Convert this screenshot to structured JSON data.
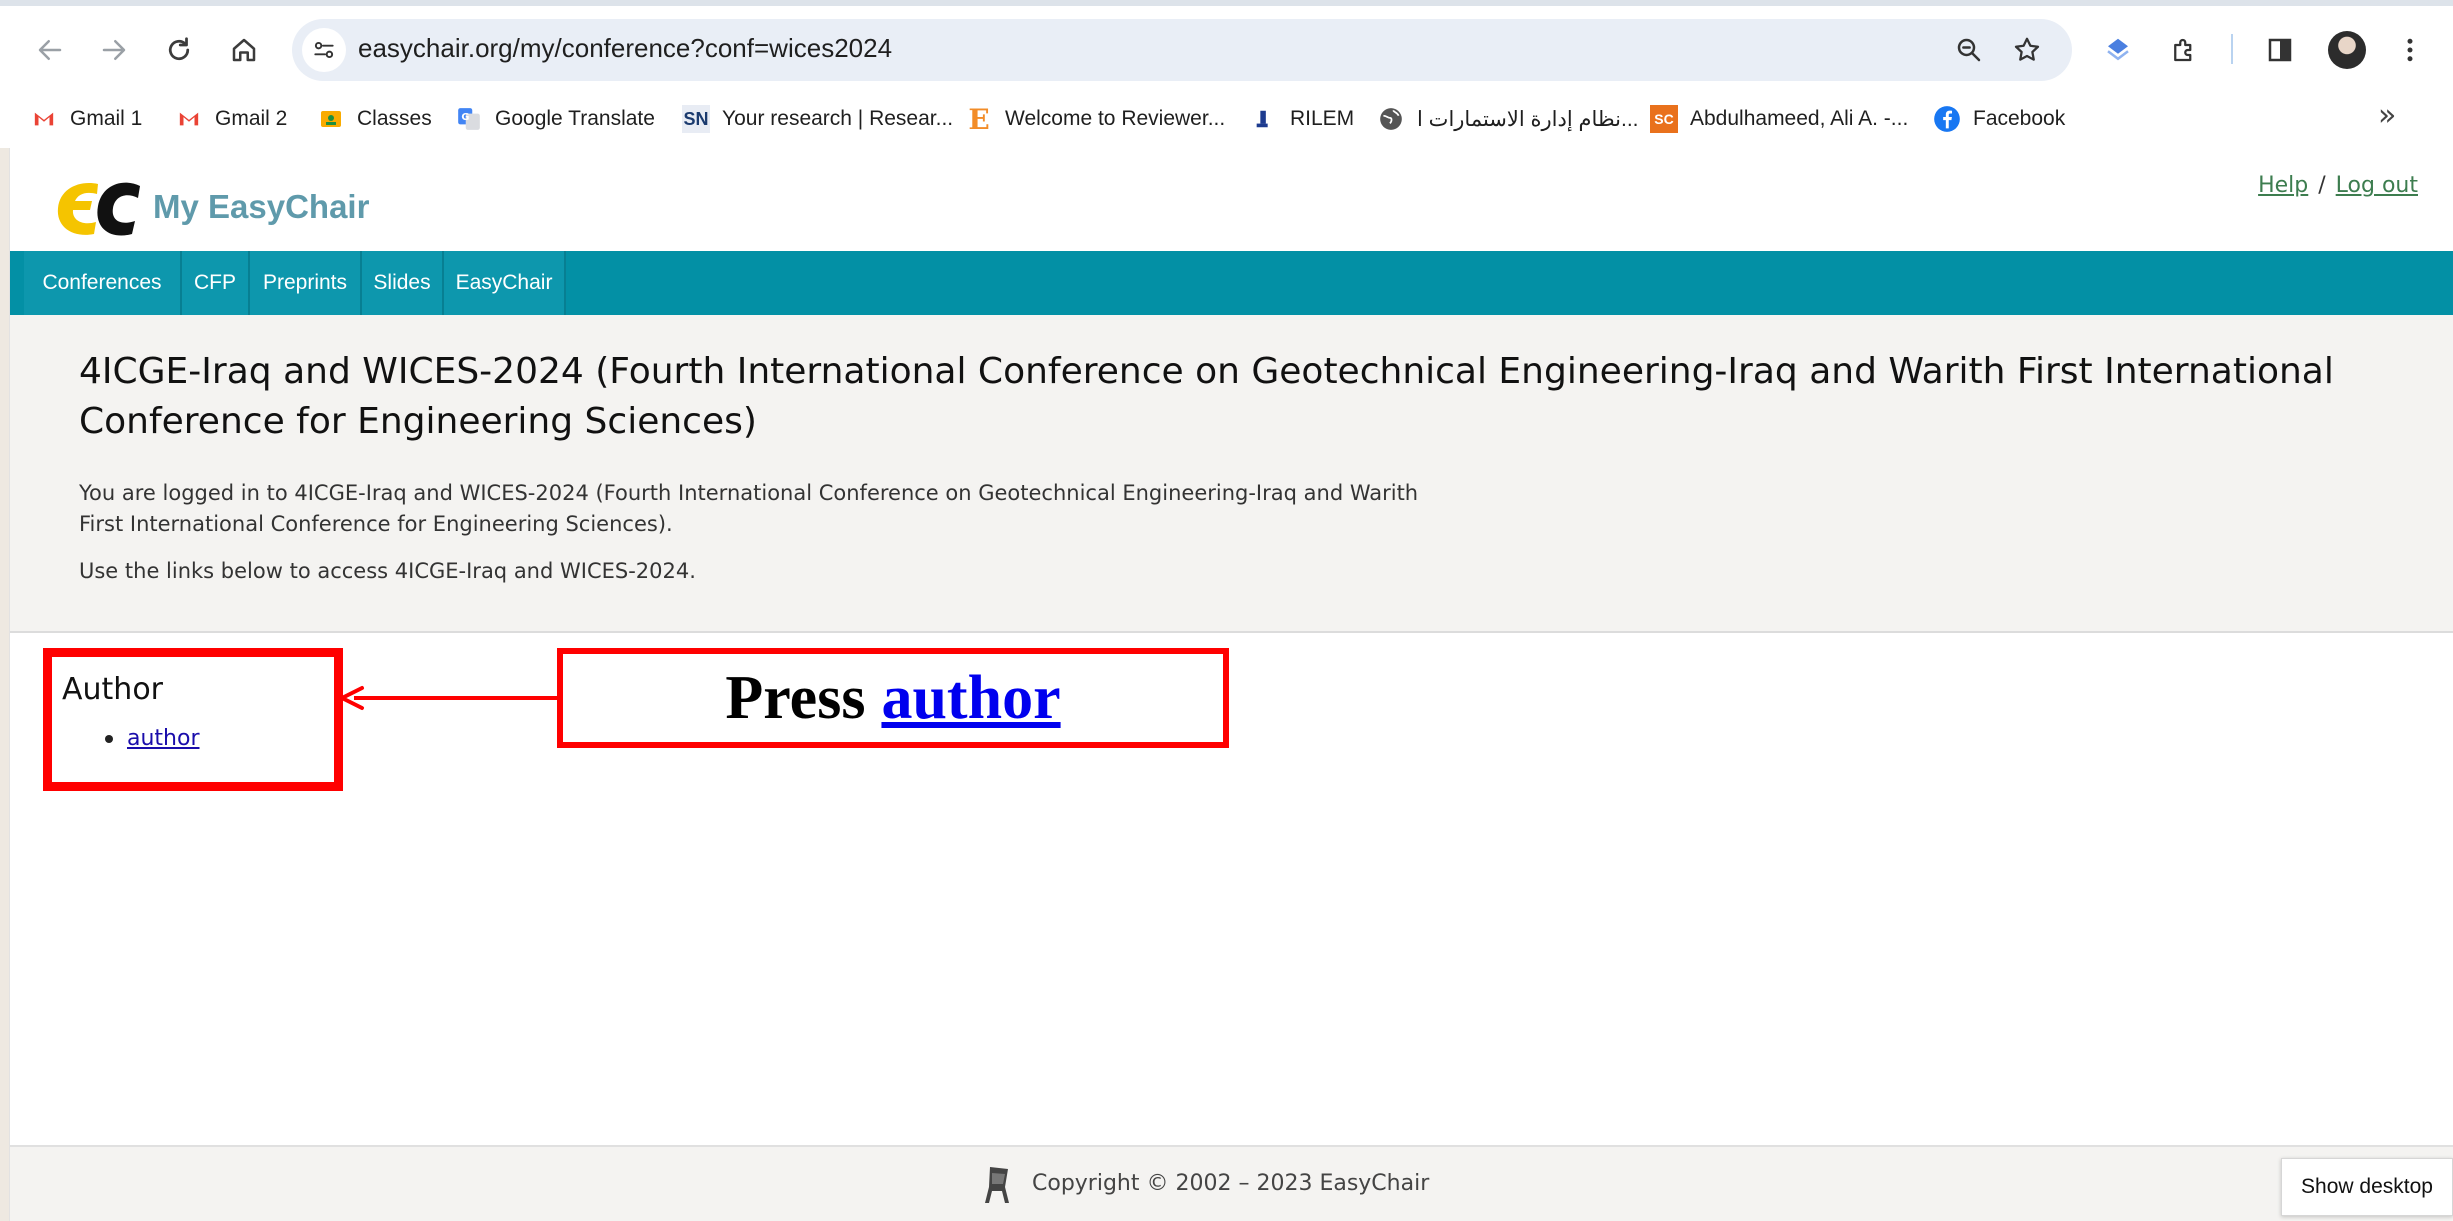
{
  "browser": {
    "url": "easychair.org/my/conference?conf=wices2024",
    "bookmarks": [
      {
        "label": "Gmail 1",
        "icon": "gmail-icon"
      },
      {
        "label": "Gmail 2",
        "icon": "gmail-icon"
      },
      {
        "label": "Classes",
        "icon": "classroom-icon"
      },
      {
        "label": "Google Translate",
        "icon": "translate-icon"
      },
      {
        "label": "Your research | Resear...",
        "icon": "sn-icon",
        "icon_text": "SN"
      },
      {
        "label": "Welcome to Reviewer...",
        "icon": "elsevier-icon",
        "icon_text": "E"
      },
      {
        "label": "RILEM",
        "icon": "rilem-icon"
      },
      {
        "label": "نظام إدارة الاستمارات ا...",
        "icon": "globe-icon"
      },
      {
        "label": "Abdulhameed, Ali A. -...",
        "icon": "sc-icon",
        "icon_text": "SC"
      },
      {
        "label": "Facebook",
        "icon": "facebook-icon"
      }
    ],
    "more_glyph": "»"
  },
  "header": {
    "brand": "My EasyChair",
    "help": "Help",
    "separator": "/",
    "logout": "Log out"
  },
  "menu": [
    "Conferences",
    "CFP",
    "Preprints",
    "Slides",
    "EasyChair"
  ],
  "conference": {
    "title": "4ICGE-Iraq and WICES-2024 (Fourth International Conference on Geotechnical Engineering-Iraq and Warith First International Conference for Engineering Sciences)",
    "logged_in_line1": "You are logged in to 4ICGE-Iraq and WICES-2024 (Fourth International Conference on Geotechnical Engineering-Iraq and Warith",
    "logged_in_line2": "First International Conference for Engineering Sciences).",
    "use_links": "Use the links below to access 4ICGE-Iraq and WICES-2024."
  },
  "author_section": {
    "heading": "Author",
    "link": "author"
  },
  "annotation": {
    "prefix": "Press",
    "link": "author"
  },
  "footer": {
    "copyright": "Copyright © 2002 – 2023 EasyChair"
  },
  "taskbar": {
    "show_desktop": "Show desktop"
  },
  "colors": {
    "menubar": "#0390a5",
    "brand": "#5f9aab",
    "annotation_red": "#ff0000"
  }
}
